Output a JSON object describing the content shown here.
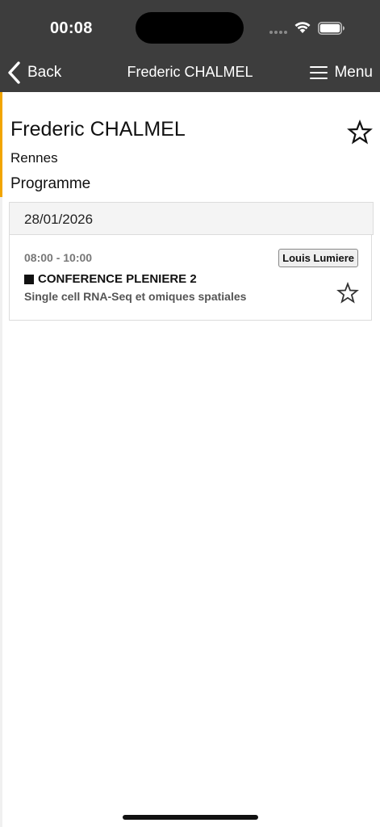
{
  "status_bar": {
    "time": "00:08",
    "icons": [
      "signal-dots-icon",
      "wifi-icon",
      "battery-icon"
    ]
  },
  "navbar": {
    "back_label": "Back",
    "title": "Frederic CHALMEL",
    "menu_label": "Menu",
    "icons": [
      "chevron-left-icon",
      "hamburger-menu-icon"
    ]
  },
  "speaker": {
    "name": "Frederic CHALMEL",
    "city": "Rennes",
    "favorite_icon": "star-outline-icon"
  },
  "programme": {
    "section_title": "Programme",
    "date": "28/01/2026",
    "sessions": [
      {
        "time": "08:00 - 10:00",
        "room": "Louis Lumiere",
        "title": "CONFERENCE PLENIERE 2",
        "subtitle": "Single cell RNA-Seq et omiques spatiales",
        "favorite_icon": "star-outline-icon"
      }
    ]
  },
  "colors": {
    "header_bg": "#3d3d3d",
    "accent": "#f2a500",
    "date_header_bg": "#f4f4f4",
    "border": "#dcdcdc"
  }
}
